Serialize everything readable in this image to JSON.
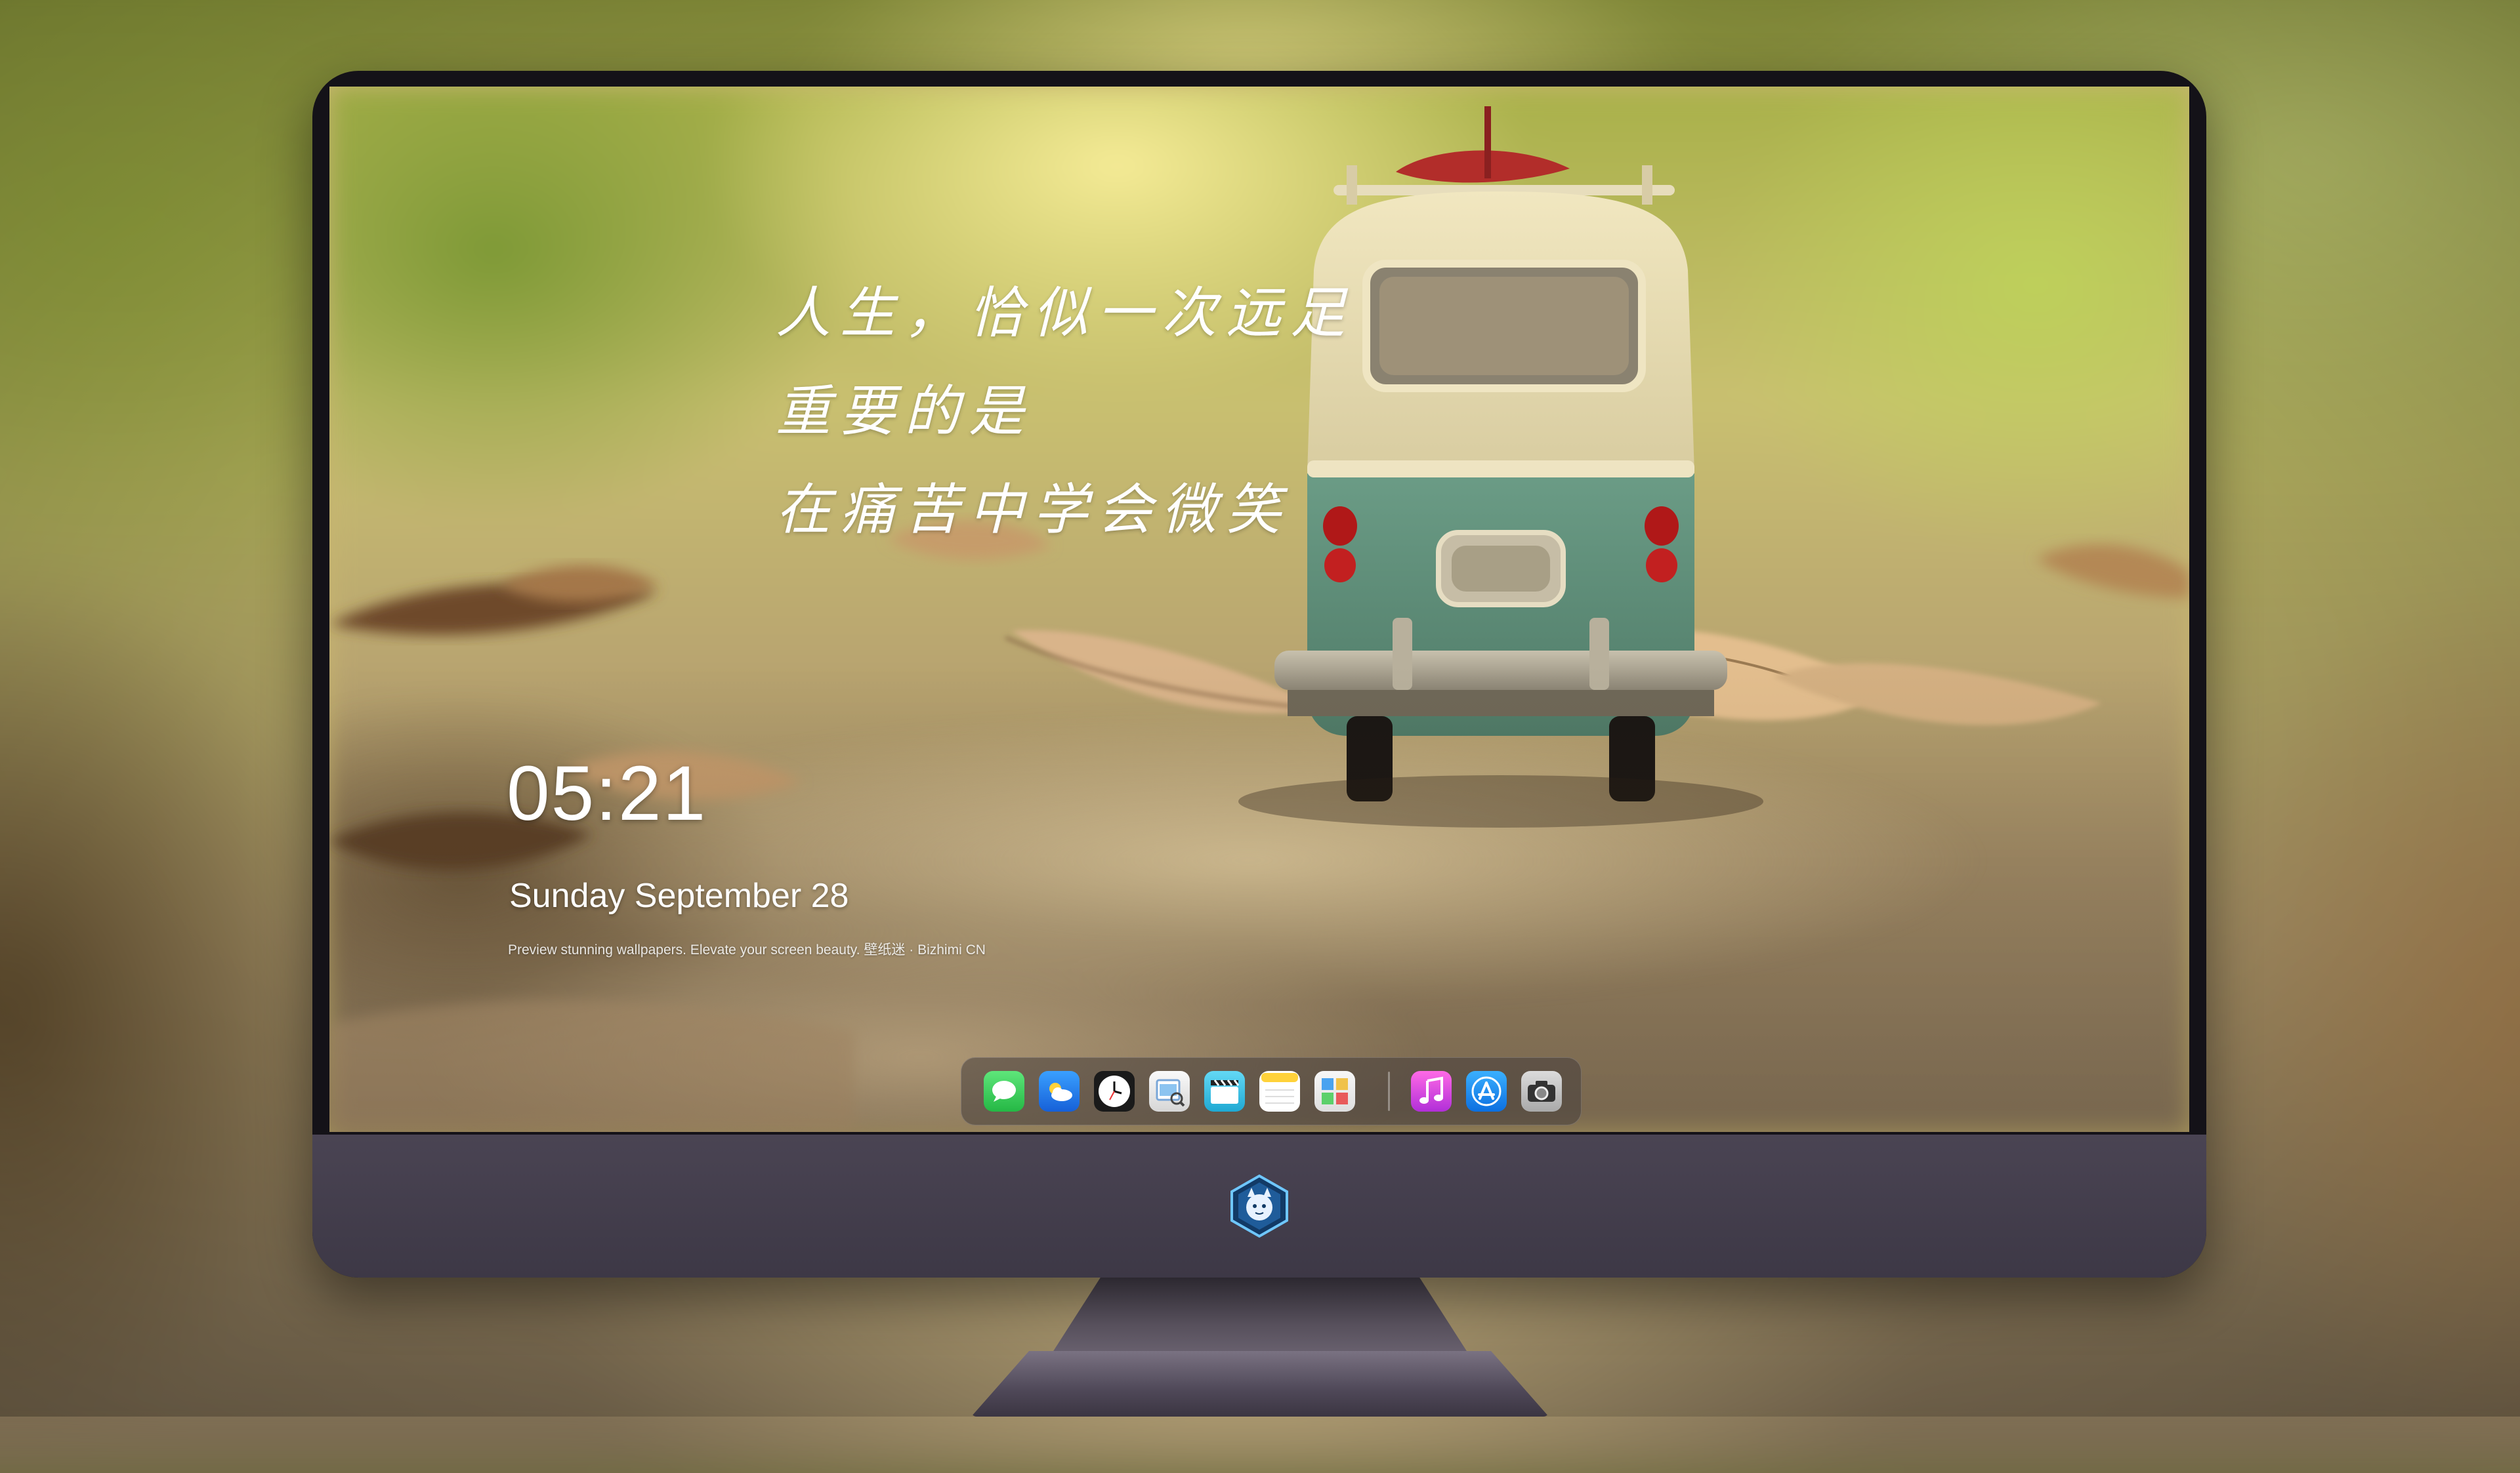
{
  "wallpaper": {
    "quote_lines": [
      "人生，恰似一次远足",
      "重要的是",
      "在痛苦中学会微笑"
    ]
  },
  "lockscreen": {
    "time": "05:21",
    "date": "Sunday September  28",
    "tagline": "Preview stunning wallpapers. Elevate your screen beauty. 壁纸迷 · Bizhimi CN"
  },
  "dock": {
    "apps": [
      {
        "name": "Messages",
        "icon": "messages-icon",
        "color": "#34c759"
      },
      {
        "name": "Weather",
        "icon": "weather-icon",
        "color": "#1e90ff"
      },
      {
        "name": "Clock",
        "icon": "clock-icon",
        "color": "#111111"
      },
      {
        "name": "Preview",
        "icon": "preview-icon",
        "color": "#e8e8e8"
      },
      {
        "name": "Clips",
        "icon": "clips-icon",
        "color": "#3cc3e8"
      },
      {
        "name": "Notes",
        "icon": "notes-icon",
        "color": "#ffd93b"
      },
      {
        "name": "Photo Booth",
        "icon": "photo-booth-icon",
        "color": "#f2f2f2"
      },
      {
        "name": "Music",
        "icon": "music-icon",
        "color": "#d13ad6"
      },
      {
        "name": "App Store",
        "icon": "app-store-icon",
        "color": "#1a8cff"
      },
      {
        "name": "Camera",
        "icon": "camera-icon",
        "color": "#bdbdbd"
      }
    ]
  },
  "monitor": {
    "chin_logo": "mascot-logo-icon",
    "bezel_color": "#141218",
    "chin_color": "#433d4c"
  }
}
